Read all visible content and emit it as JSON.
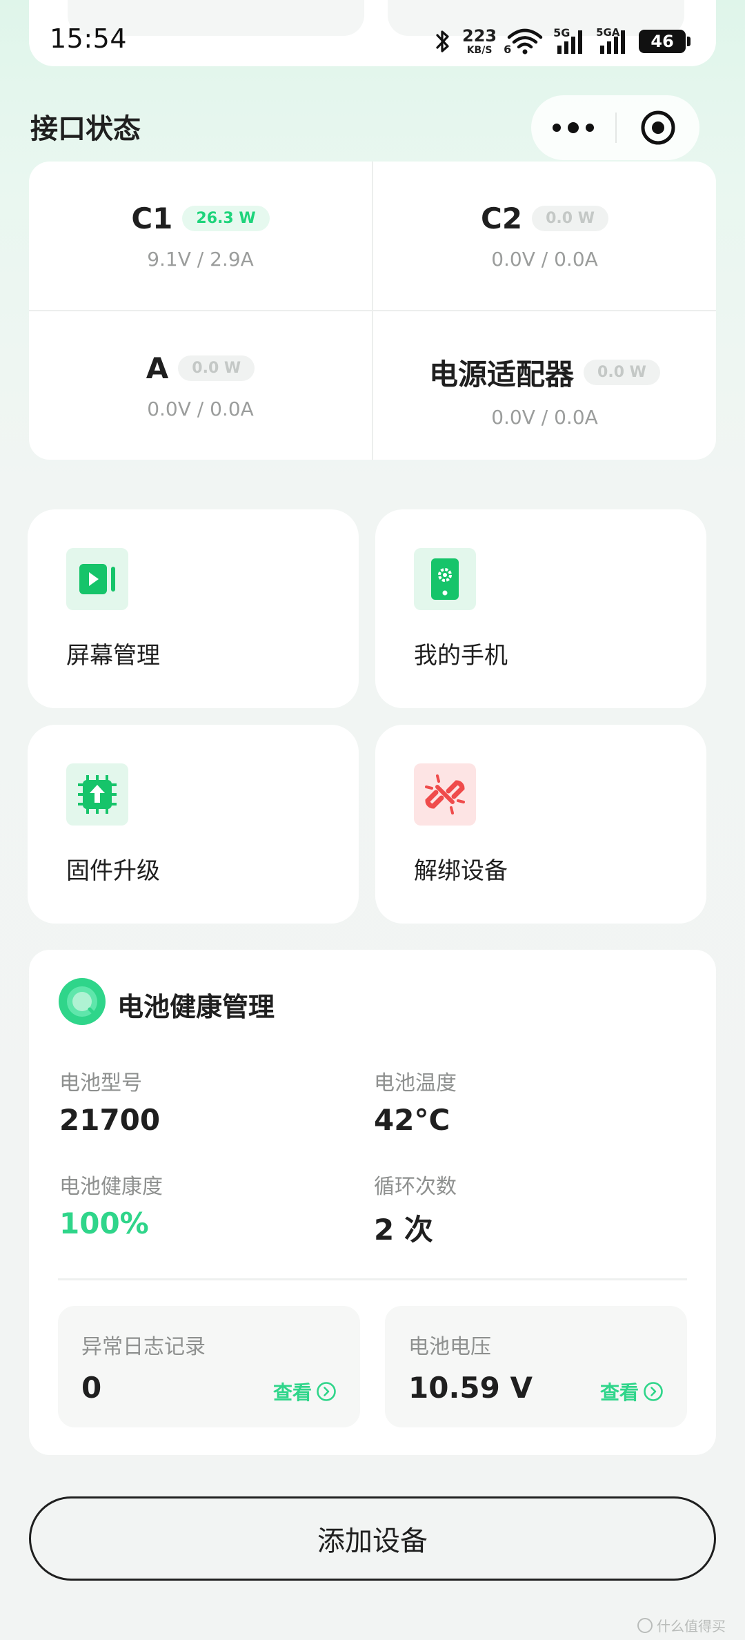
{
  "status_bar": {
    "time": "15:54",
    "net_speed": "223",
    "net_unit": "KB/S",
    "wifi_badge": "6",
    "sim1": "5G",
    "sim2": "5GA",
    "battery": "46",
    "icons": [
      "bluetooth-icon",
      "wifi-icon",
      "signal-icon",
      "signal-icon",
      "battery-icon"
    ]
  },
  "header": {
    "title": "接口状态",
    "menu_icon": "more-dots-icon",
    "close_icon": "target-circle-icon"
  },
  "ports": [
    {
      "name": "C1",
      "power": "26.3 W",
      "active": true,
      "vi": "9.1V / 2.9A"
    },
    {
      "name": "C2",
      "power": "0.0 W",
      "active": false,
      "vi": "0.0V / 0.0A"
    },
    {
      "name": "A",
      "power": "0.0 W",
      "active": false,
      "vi": "0.0V / 0.0A"
    },
    {
      "name": "电源适配器",
      "power": "0.0 W",
      "active": false,
      "vi": "0.0V / 0.0A"
    }
  ],
  "functions": [
    {
      "label": "屏幕管理",
      "icon": "screen-play-icon",
      "color": "#16c46a"
    },
    {
      "label": "我的手机",
      "icon": "phone-settings-icon",
      "color": "#16c46a"
    },
    {
      "label": "固件升级",
      "icon": "chip-upgrade-icon",
      "color": "#16c46a"
    },
    {
      "label": "解绑设备",
      "icon": "unlink-icon",
      "color": "#ef4b4b"
    }
  ],
  "battery": {
    "title": "电池健康管理",
    "model_label": "电池型号",
    "model_value": "21700",
    "temp_label": "电池温度",
    "temp_value": "42°C",
    "health_label": "电池健康度",
    "health_value": "100%",
    "cycles_label": "循环次数",
    "cycles_value": "2 次",
    "log_label": "异常日志记录",
    "log_value": "0",
    "log_link": "查看",
    "voltage_label": "电池电压",
    "voltage_value": "10.59 V",
    "voltage_link": "查看",
    "accent": "#2fd58a"
  },
  "add_device": "添加设备",
  "watermark": "什么值得买"
}
